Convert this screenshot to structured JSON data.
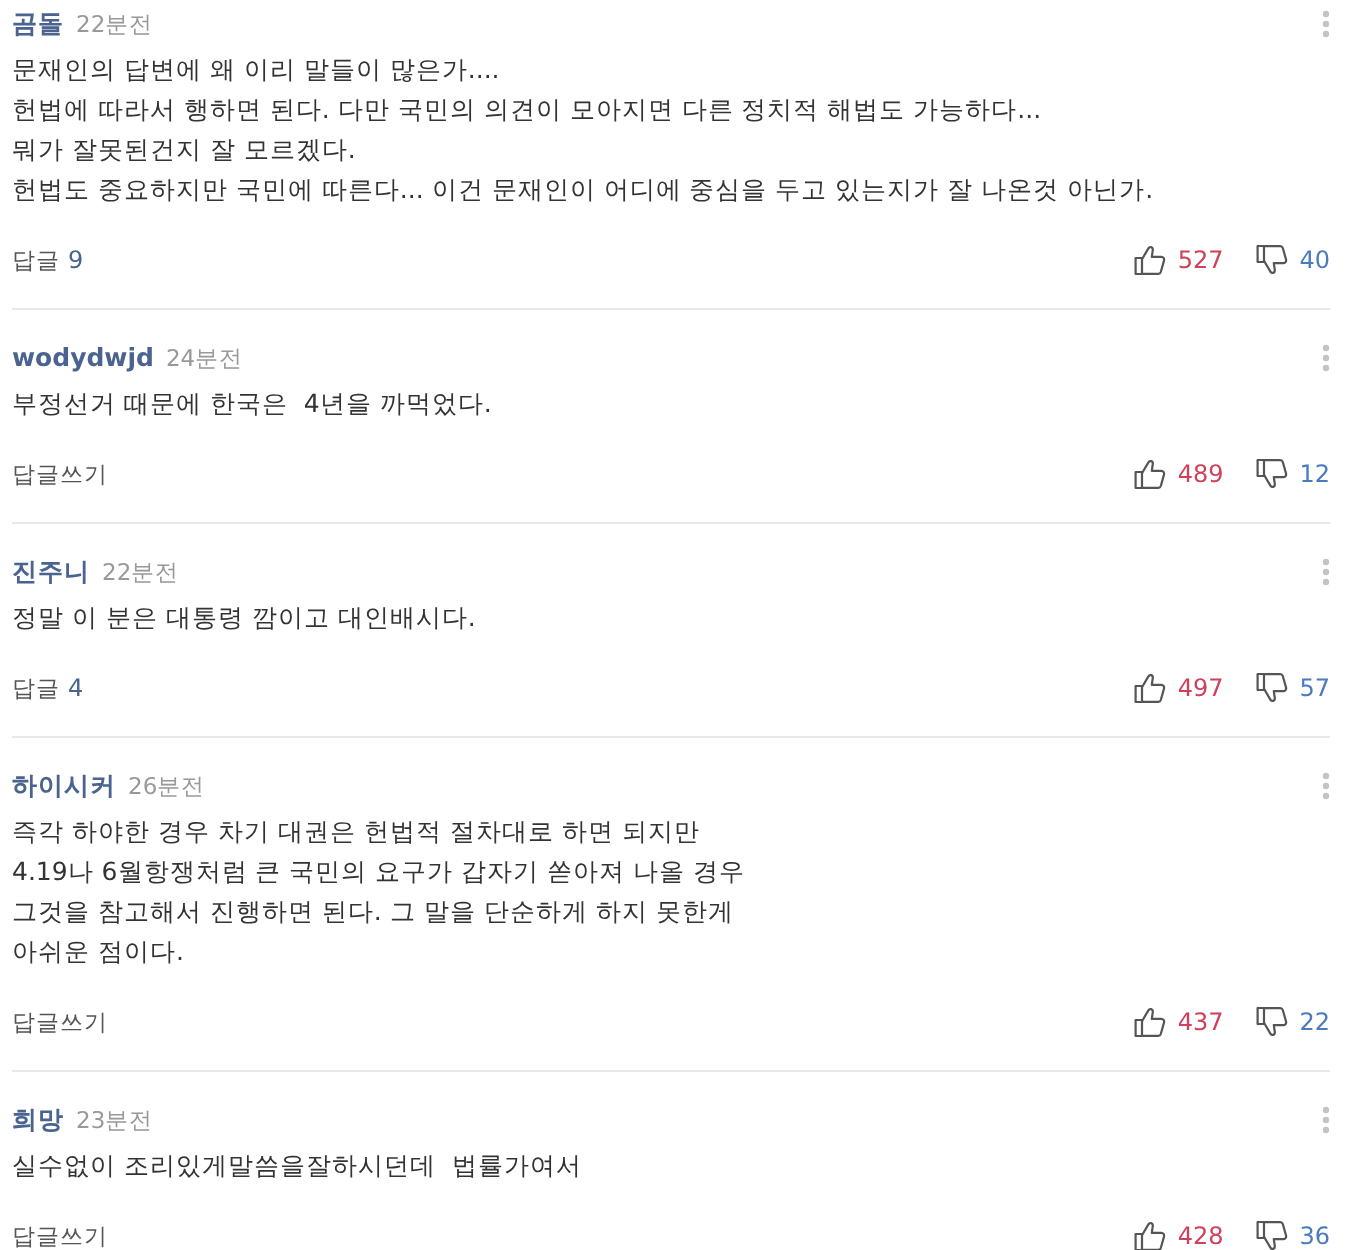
{
  "comments": [
    {
      "author": "곰돌",
      "time": "22분전",
      "text": "문재인의 답변에 왜 이리 말들이 많은가....\n헌법에 따라서 행하면 된다. 다만 국민의 의견이 모아지면 다른 정치적 해법도 가능하다...\n뭐가 잘못된건지 잘 모르겠다.\n헌법도 중요하지만 국민에 따른다... 이건 문재인이 어디에 중심을 두고 있는지가 잘 나온것 아닌가.",
      "reply": {
        "label": "답글",
        "count": "9"
      },
      "likes": "527",
      "dislikes": "40"
    },
    {
      "author": "wodydwjd",
      "time": "24분전",
      "text": "부정선거 때문에 한국은  4년을 까먹었다.",
      "reply": {
        "label": "답글쓰기"
      },
      "likes": "489",
      "dislikes": "12"
    },
    {
      "author": "진주니",
      "time": "22분전",
      "text": "정말 이 분은 대통령 깜이고 대인배시다.",
      "reply": {
        "label": "답글",
        "count": "4"
      },
      "likes": "497",
      "dislikes": "57"
    },
    {
      "author": "하이시커",
      "time": "26분전",
      "text": "즉각 하야한 경우 차기 대권은 헌법적 절차대로 하면 되지만\n4.19나 6월항쟁처럼 큰 국민의 요구가 갑자기 쏟아져 나올 경우\n그것을 참고해서 진행하면 된다. 그 말을 단순하게 하지 못한게\n아쉬운 점이다.",
      "reply": {
        "label": "답글쓰기"
      },
      "likes": "437",
      "dislikes": "22"
    },
    {
      "author": "희망",
      "time": "23분전",
      "text": "실수없이 조리있게말씀을잘하시던데  법률가여서",
      "reply": {
        "label": "답글쓰기"
      },
      "likes": "428",
      "dislikes": "36"
    }
  ]
}
